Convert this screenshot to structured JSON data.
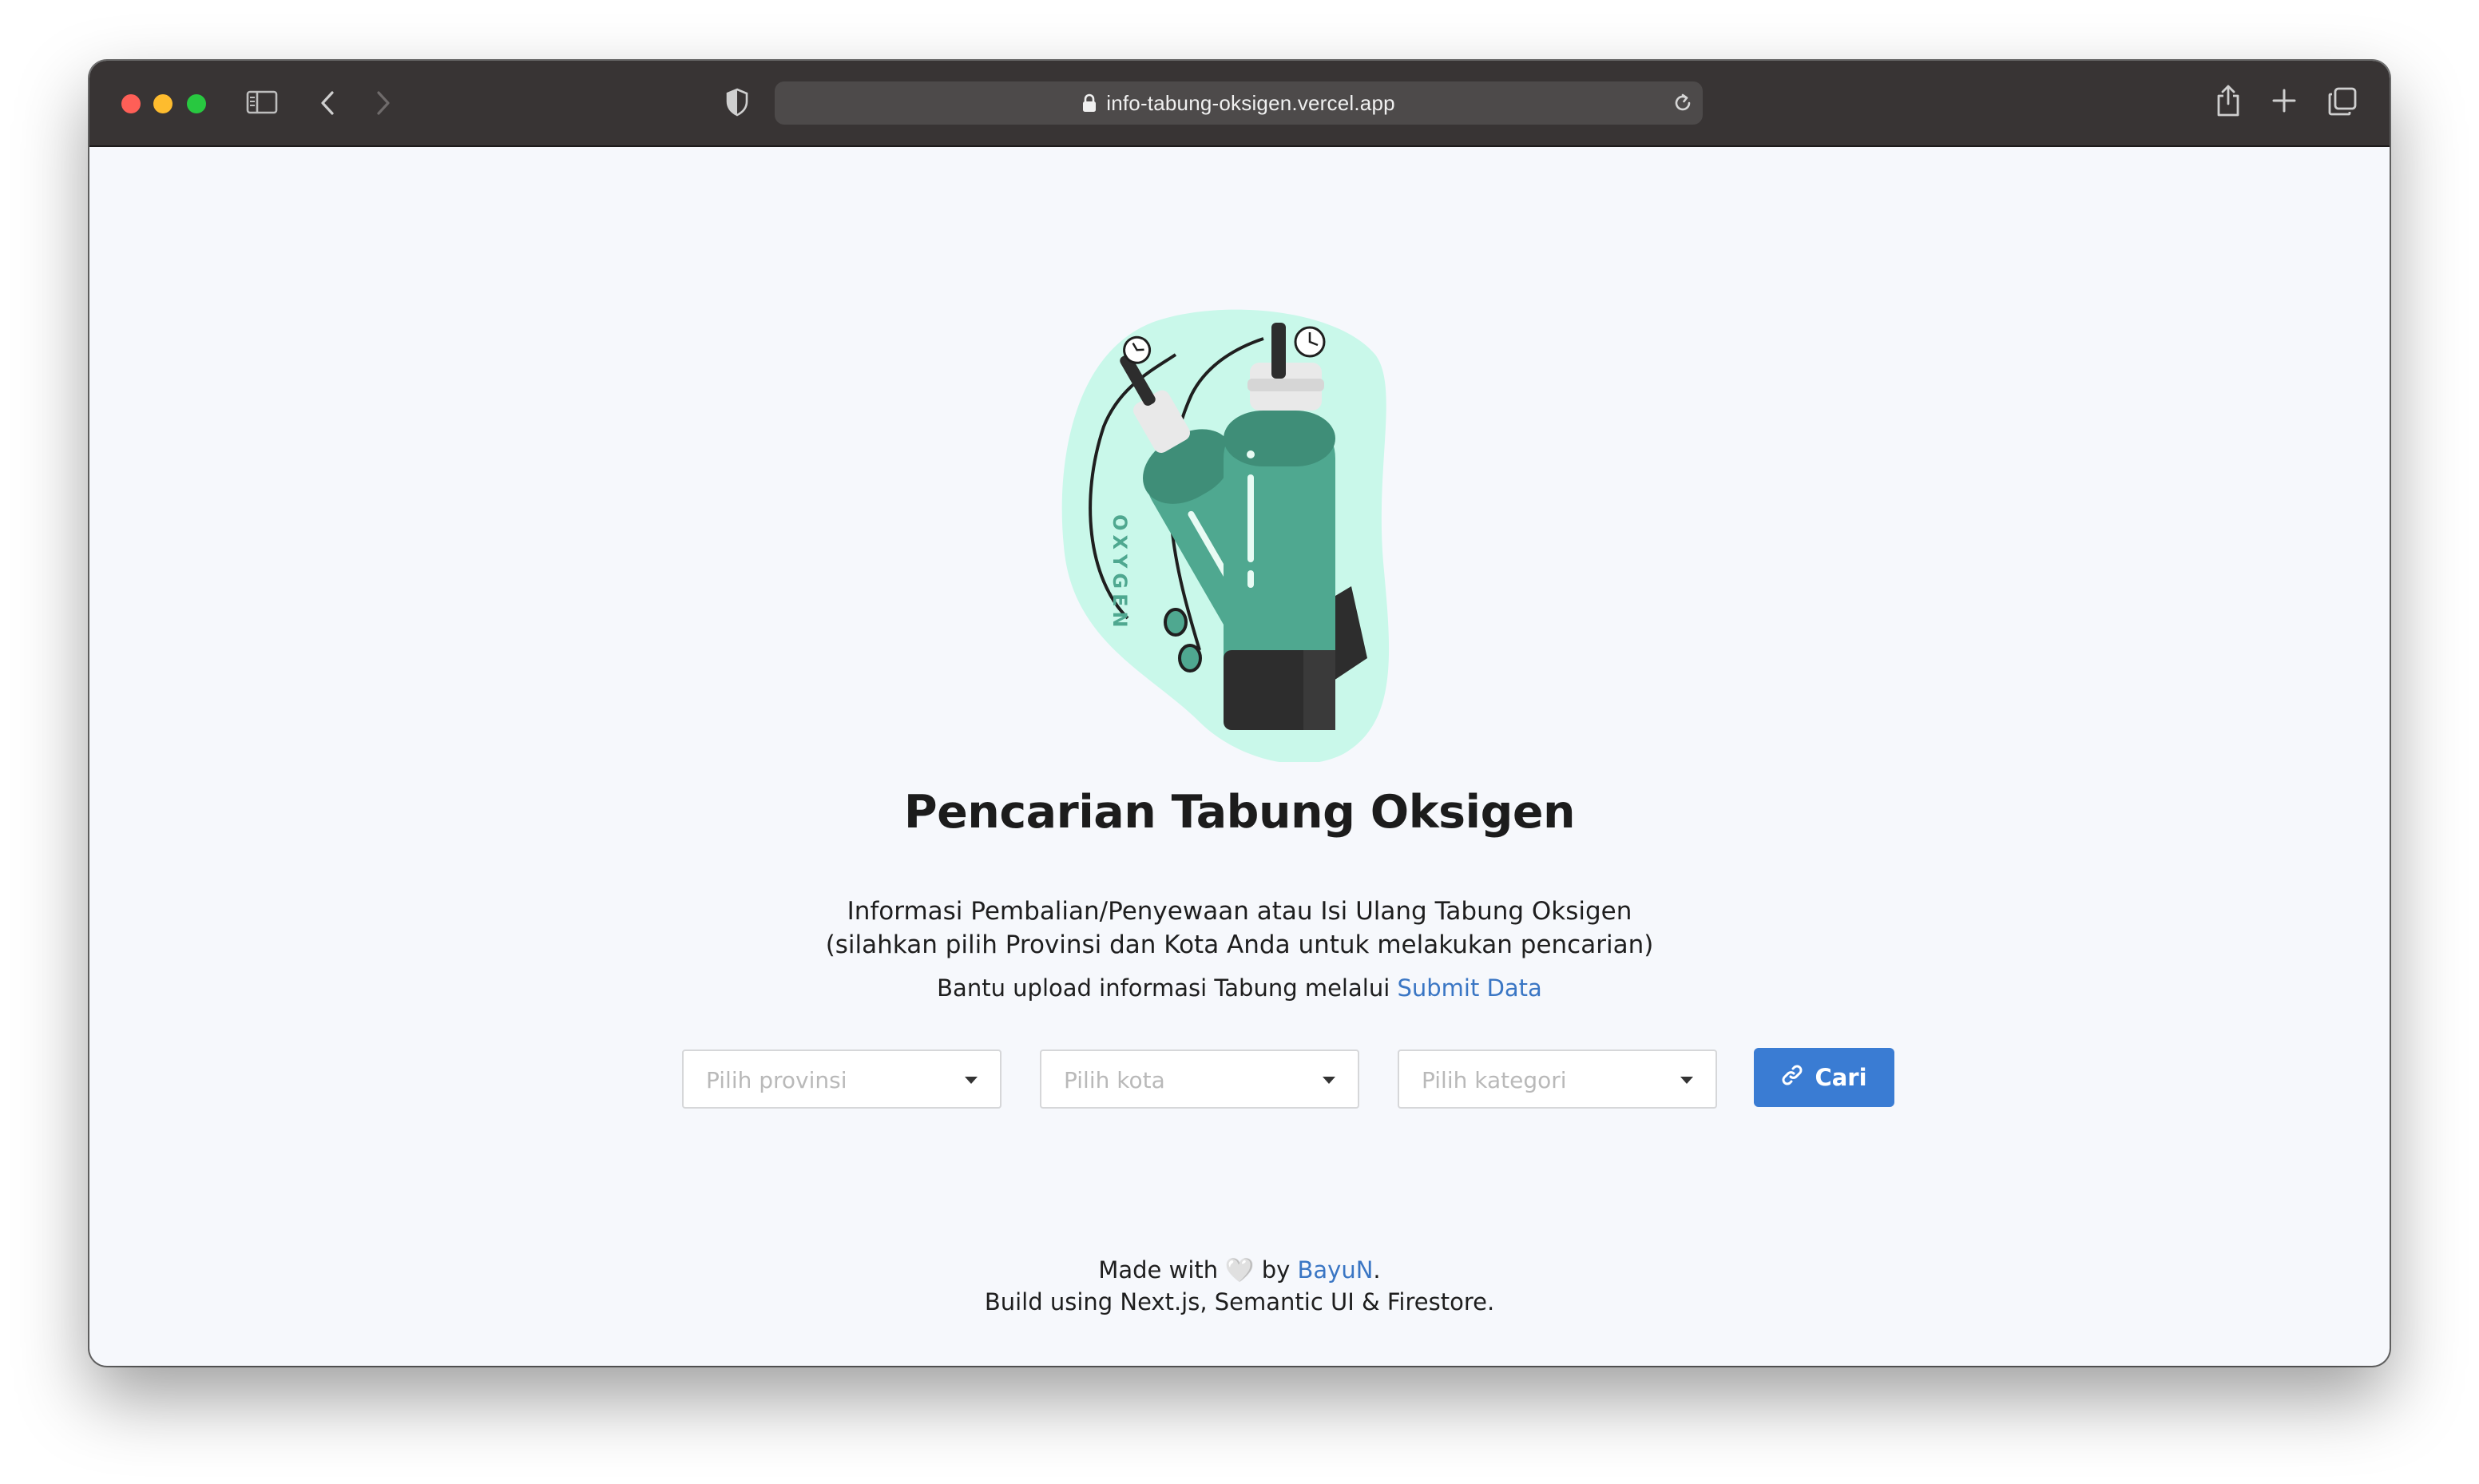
{
  "browser": {
    "url": "info-tabung-oksigen.vercel.app"
  },
  "hero": {
    "illustration_text": "OXYGEN",
    "colors": {
      "blob": "#c9f8ea",
      "tank": "#4fa890",
      "tank_dark": "#3f8e78",
      "base": "#2d2d2d"
    }
  },
  "page": {
    "title": "Pencarian Tabung Oksigen",
    "subtitle_line1": "Informasi Pembalian/Penyewaan atau Isi Ulang Tabung Oksigen",
    "subtitle_line2": "(silahkan pilih Provinsi dan Kota Anda untuk melakukan pencarian)",
    "helper_text": "Bantu upload informasi Tabung melalui ",
    "helper_link": "Submit Data"
  },
  "search": {
    "province_placeholder": "Pilih provinsi",
    "city_placeholder": "Pilih kota",
    "category_placeholder": "Pilih kategori",
    "button_label": "Cari"
  },
  "footer": {
    "made_with": "Made with",
    "heart": "🤍",
    "by": "by",
    "author": "BayuN",
    "period": ".",
    "build_line": "Build using Next.js, Semantic UI & Firestore."
  },
  "colors": {
    "accent": "#3a7cd3",
    "link": "#3a76c4",
    "titlebar": "#383434",
    "page_bg": "#f6f8fc"
  }
}
